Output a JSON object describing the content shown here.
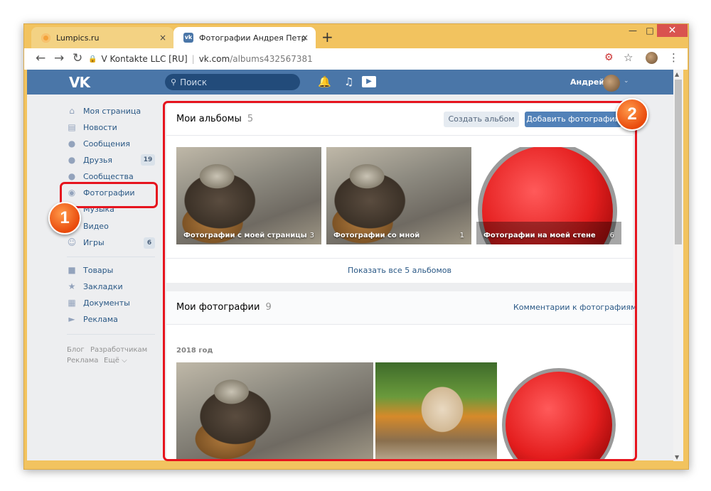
{
  "browser": {
    "tabs": [
      {
        "title": "Lumpics.ru"
      },
      {
        "title": "Фотографии Андрея Петрова –"
      }
    ],
    "close_glyph": "×",
    "new_tab_glyph": "+",
    "site_info": "V Kontakte LLC [RU]",
    "url_host": "vk.com",
    "url_path": "/albums432567381"
  },
  "vk_header": {
    "logo": "VK",
    "search_placeholder": "Поиск",
    "user_name": "Андрей"
  },
  "sidebar": {
    "items": [
      {
        "label": "Моя страница",
        "icon": "home-icon"
      },
      {
        "label": "Новости",
        "icon": "news-icon"
      },
      {
        "label": "Сообщения",
        "icon": "messages-icon"
      },
      {
        "label": "Друзья",
        "icon": "friends-icon",
        "badge": "19"
      },
      {
        "label": "Сообщества",
        "icon": "groups-icon"
      },
      {
        "label": "Фотографии",
        "icon": "camera-icon"
      },
      {
        "label": "Музыка",
        "icon": "music-icon"
      },
      {
        "label": "Видео",
        "icon": "video-icon"
      },
      {
        "label": "Игры",
        "icon": "games-icon",
        "badge": "6"
      },
      {
        "label": "Товары",
        "icon": "shop-icon"
      },
      {
        "label": "Закладки",
        "icon": "star-icon"
      },
      {
        "label": "Документы",
        "icon": "document-icon"
      },
      {
        "label": "Реклама",
        "icon": "ads-icon"
      }
    ],
    "footer": [
      "Блог",
      "Разработчикам",
      "Реклама",
      "Ещё ⌵"
    ]
  },
  "albums": {
    "title": "Мои альбомы",
    "count": "5",
    "create_button": "Создать альбом",
    "add_button": "Добавить фотографии",
    "items": [
      {
        "label": "Фотографии с моей страницы",
        "count": "3"
      },
      {
        "label": "Фотографии со мной",
        "count": "1"
      },
      {
        "label": "Фотографии на моей стене",
        "count": "6"
      }
    ],
    "show_all": "Показать все 5 альбомов"
  },
  "photos": {
    "title": "Мои фотографии",
    "count": "9",
    "comments_link": "Комментарии к фотографиям",
    "year": "2018 год"
  },
  "annotations": {
    "marker1": "1",
    "marker2": "2"
  },
  "colors": {
    "vk_blue": "#4a76a8",
    "annotation_red": "#e6141e",
    "marker_orange": "#e94a0c",
    "button_blue": "#5181b8"
  }
}
